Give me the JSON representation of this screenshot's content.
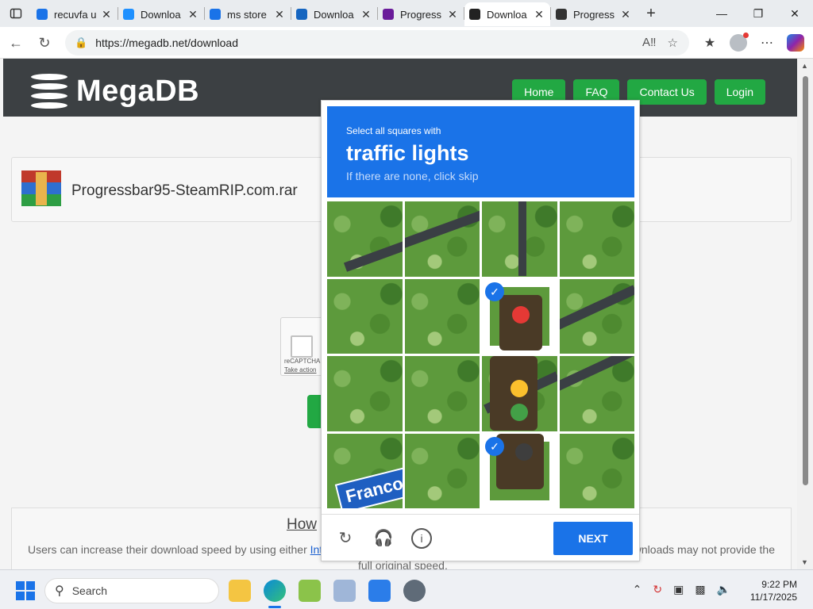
{
  "browser": {
    "tabs": [
      {
        "label": "recuvfa u",
        "favicon_color": "#1a73e8",
        "active": false
      },
      {
        "label": "Downloa",
        "favicon_color": "#1e90ff",
        "active": false
      },
      {
        "label": "ms store",
        "favicon_color": "#1a73e8",
        "active": false
      },
      {
        "label": "Downloa",
        "favicon_color": "#1565c0",
        "active": false
      },
      {
        "label": "Progress",
        "favicon_color": "#6a1b9a",
        "active": false
      },
      {
        "label": "Downloa",
        "favicon_color": "#222222",
        "active": true
      },
      {
        "label": "Progress",
        "favicon_color": "#333333",
        "active": false
      }
    ],
    "url": "https://megadb.net/download"
  },
  "site": {
    "logo": "MegaDB",
    "nav": [
      "Home",
      "FAQ",
      "Contact Us",
      "Login"
    ],
    "filename": "Progressbar95-SteamRIP.com.rar",
    "recaptcha_label": "reCAPTCHA",
    "recaptcha_link": "Take action",
    "how_title": "How",
    "how_text_start": "Users can increase their download speed by using either",
    "how_link": "Inte",
    "how_text_end": "wnloads may not provide the",
    "how_text_line2": "full original speed."
  },
  "captcha": {
    "instruction": "Select all squares with",
    "target": "traffic lights",
    "hint": "If there are none, click skip",
    "street_sign": "Franconia Rd",
    "selected_tiles": [
      6,
      14
    ],
    "next_label": "NEXT",
    "icons": [
      "reload-icon",
      "audio-icon",
      "info-icon"
    ]
  },
  "taskbar": {
    "search_placeholder": "Search",
    "time": "9:22 PM",
    "date": "11/17/2025"
  }
}
